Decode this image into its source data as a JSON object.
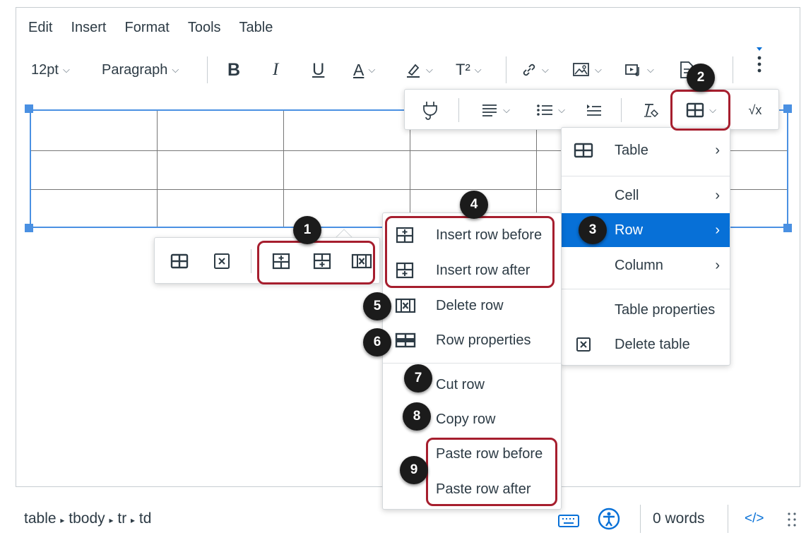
{
  "menubar": [
    "Edit",
    "Insert",
    "Format",
    "Tools",
    "Table"
  ],
  "toolbar": {
    "font_size": "12pt",
    "block_format": "Paragraph",
    "bold": "B",
    "italic": "I",
    "underline": "U",
    "text_color": "A",
    "superscript": "T²",
    "math": "√x"
  },
  "table_menu": {
    "items": [
      {
        "label": "Table",
        "icon": "table-icon"
      },
      {
        "label": "Cell"
      },
      {
        "label": "Row"
      },
      {
        "label": "Column"
      },
      {
        "label": "Table properties"
      },
      {
        "label": "Delete table",
        "icon": "delete-table-icon"
      }
    ],
    "active": "Row",
    "highlight_color": "#0770d7"
  },
  "row_menu": {
    "items": [
      {
        "label": "Insert row before",
        "icon": "insert-row-before-icon"
      },
      {
        "label": "Insert row after",
        "icon": "insert-row-after-icon"
      },
      {
        "label": "Delete row",
        "icon": "delete-row-icon"
      },
      {
        "label": "Row properties",
        "icon": "row-properties-icon"
      },
      {
        "label": "Cut row"
      },
      {
        "label": "Copy row"
      },
      {
        "label": "Paste row before"
      },
      {
        "label": "Paste row after"
      }
    ]
  },
  "callouts": [
    "1",
    "2",
    "3",
    "4",
    "5",
    "6",
    "7",
    "8",
    "9"
  ],
  "statusbar": {
    "path": [
      "table",
      "tbody",
      "tr",
      "td"
    ],
    "word_count": "0 words",
    "html_toggle": "</>"
  },
  "colors": {
    "accent": "#0770d7",
    "callout_outline": "#a61e2e",
    "selection": "#4a90e2"
  }
}
